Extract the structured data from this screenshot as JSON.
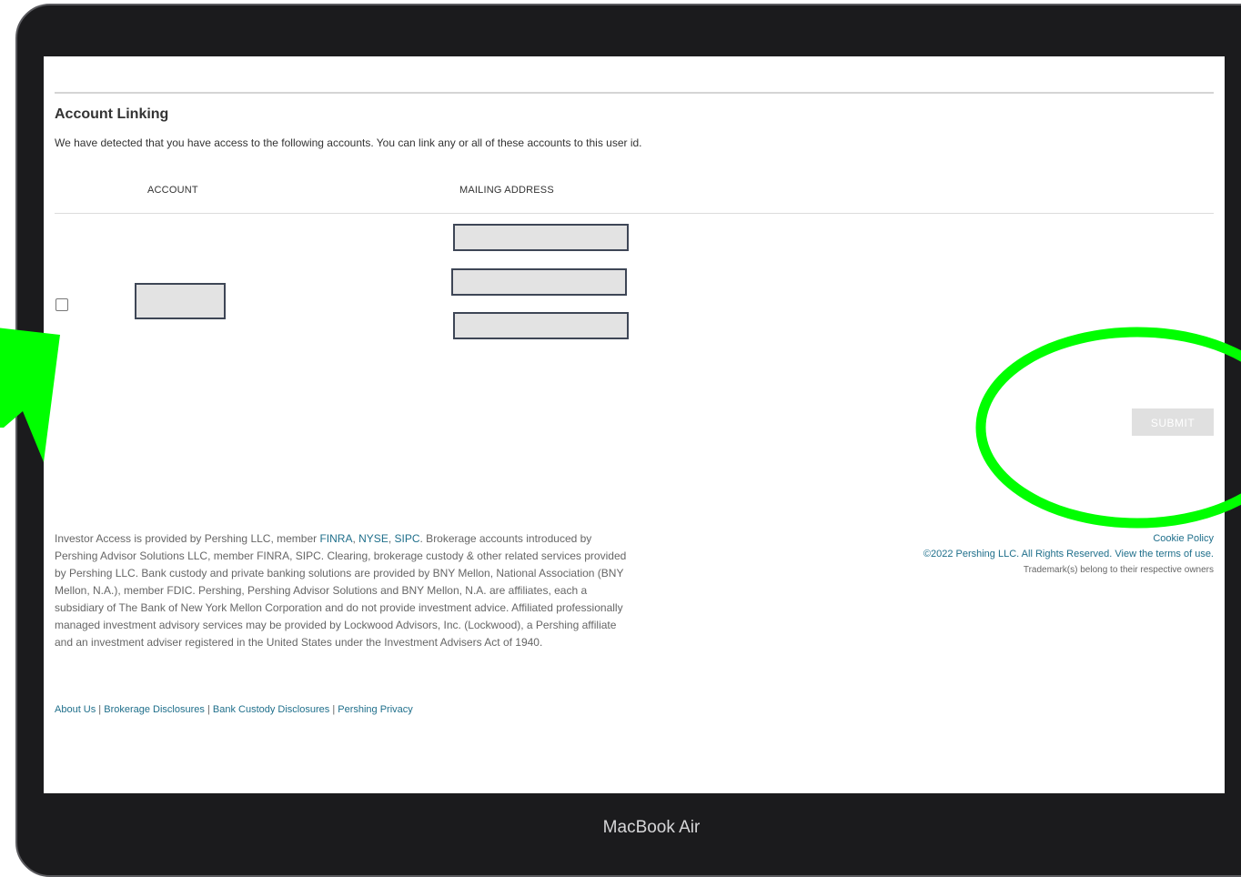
{
  "device_label": "MacBook Air",
  "page": {
    "title": "Account Linking",
    "description": "We have detected that you have access to the following accounts. You can link any or all of these accounts to this user id.",
    "columns": [
      "ACCOUNT",
      "MAILING ADDRESS"
    ],
    "submit_label": "SUBMIT"
  },
  "footer": {
    "legal_prefix": "Investor Access is provided by Pershing LLC, member ",
    "finra": "FINRA",
    "sep1": ", ",
    "nyse": "NYSE",
    "sep2": ", ",
    "sipc": "SIPC",
    "legal_body": ". Brokerage accounts introduced by Pershing Advisor Solutions LLC, member FINRA, SIPC. Clearing, brokerage custody & other related services provided by Pershing LLC. Bank custody and private banking solutions are provided by BNY Mellon, National Association (BNY Mellon, N.A.), member FDIC. Pershing, Pershing Advisor Solutions and BNY Mellon, N.A. are affiliates, each a subsidiary of The Bank of New York Mellon Corporation and do not provide investment advice. Affiliated professionally managed investment advisory services may be provided by Lockwood Advisors, Inc. (Lockwood), a Pershing affiliate and an investment adviser registered in the United States under the Investment Advisers Act of 1940.",
    "links": [
      "About Us",
      "Brokerage Disclosures",
      "Bank Custody Disclosures",
      "Pershing Privacy"
    ],
    "link_separator": " | ",
    "cookie_policy": "Cookie Policy",
    "copyright": "©2022 Pershing LLC. All Rights Reserved. View the terms of use.",
    "trademark": "Trademark(s) belong to their respective owners"
  },
  "annotation": {
    "color": "#00ff00",
    "arrow": "up-arrow-icon",
    "circle": "highlight-circle"
  }
}
